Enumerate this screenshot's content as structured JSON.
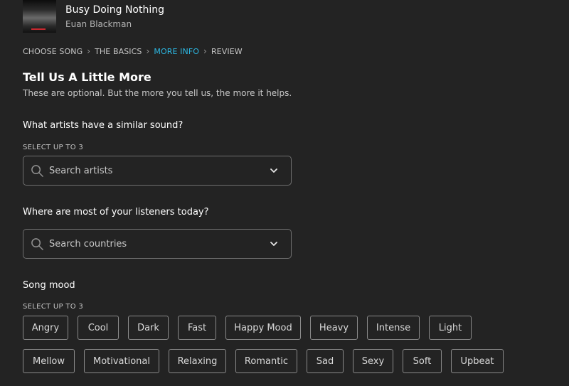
{
  "song": {
    "title": "Busy Doing Nothing",
    "artist": "Euan Blackman"
  },
  "breadcrumb": [
    {
      "label": "CHOOSE SONG",
      "active": false
    },
    {
      "label": "THE BASICS",
      "active": false
    },
    {
      "label": "MORE INFO",
      "active": true
    },
    {
      "label": "REVIEW",
      "active": false
    }
  ],
  "section": {
    "title": "Tell Us A Little More",
    "subtitle": "These are optional. But the more you tell us, the more it helps."
  },
  "artists": {
    "question": "What artists have a similar sound?",
    "caption": "SELECT UP TO 3",
    "placeholder": "Search artists"
  },
  "countries": {
    "question": "Where are most of your listeners today?",
    "placeholder": "Search countries"
  },
  "mood": {
    "question": "Song mood",
    "caption": "SELECT UP TO 3",
    "rows": [
      [
        "Angry",
        "Cool",
        "Dark",
        "Fast",
        "Happy Mood",
        "Heavy",
        "Intense",
        "Light"
      ],
      [
        "Mellow",
        "Motivational",
        "Relaxing",
        "Romantic",
        "Sad",
        "Sexy",
        "Soft",
        "Upbeat"
      ]
    ]
  },
  "colors": {
    "background": "#232323",
    "accent": "#2cb8e3",
    "border": "#8a8a8a"
  },
  "icons": [
    "search-icon",
    "chevron-down-icon",
    "chevron-right-icon"
  ]
}
